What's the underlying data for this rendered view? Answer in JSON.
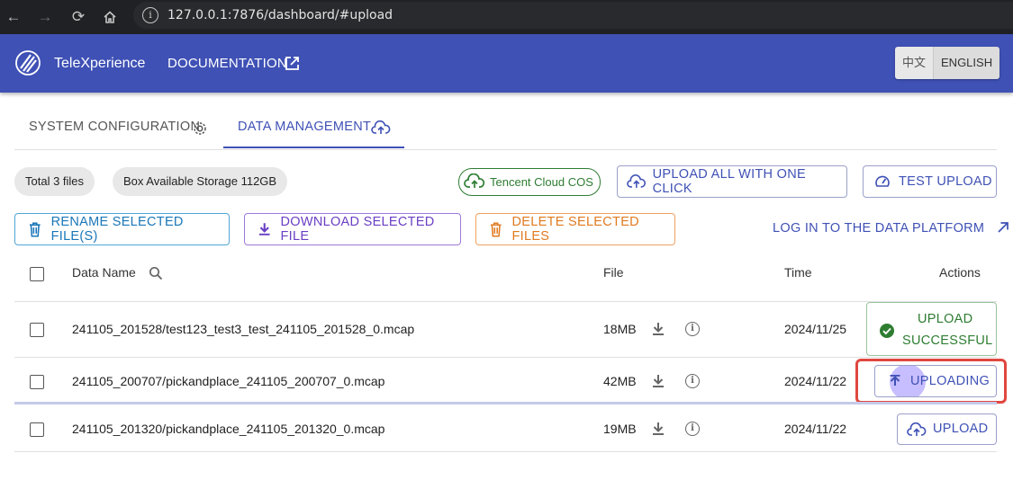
{
  "browser": {
    "url": "127.0.0.1:7876/dashboard/#upload"
  },
  "header": {
    "brand": "TeleXperience",
    "docs": "DOCUMENTATION",
    "lang_zh": "中文",
    "lang_en": "ENGLISH"
  },
  "tabs": [
    {
      "label": "SYSTEM CONFIGURATION"
    },
    {
      "label": "DATA MANAGEMENT"
    }
  ],
  "stats": {
    "total": "Total 3 files",
    "storage": "Box Available Storage 112GB",
    "cos": "Tencent Cloud COS"
  },
  "buttons": {
    "upload_all": "UPLOAD ALL WITH ONE CLICK",
    "test_upload": "TEST UPLOAD",
    "rename": "RENAME SELECTED FILE(S)",
    "download": "DOWNLOAD SELECTED FILE",
    "delete": "DELETE SELECTED FILES",
    "platform": "LOG IN TO THE DATA PLATFORM"
  },
  "table": {
    "headers": {
      "name": "Data Name",
      "file": "File",
      "time": "Time",
      "actions": "Actions"
    },
    "rows": [
      {
        "name": "241105_201528/test123_test3_test_241105_201528_0.mcap",
        "size": "18MB",
        "time": "2024/11/25",
        "action_line1": "UPLOAD",
        "action_line2": "SUCCESSFUL"
      },
      {
        "name": "241105_200707/pickandplace_241105_200707_0.mcap",
        "size": "42MB",
        "time": "2024/11/22",
        "action": "UPLOADING"
      },
      {
        "name": "241105_201320/pickandplace_241105_201320_0.mcap",
        "size": "19MB",
        "time": "2024/11/22",
        "action": "UPLOAD"
      }
    ]
  },
  "colors": {
    "primary": "#3f51b5",
    "success": "#2e7d32",
    "highlight": "#e0473f"
  }
}
